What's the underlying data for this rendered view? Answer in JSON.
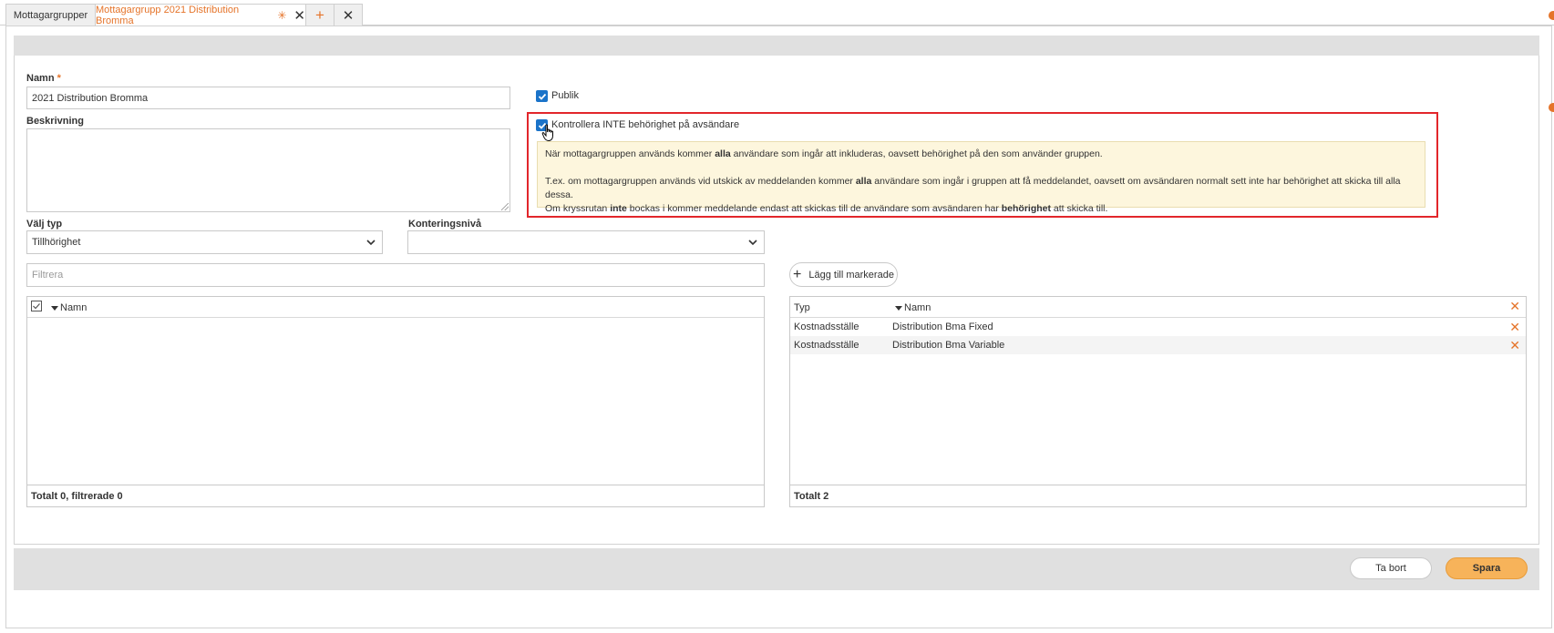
{
  "tabs": [
    {
      "label": "Mottagargrupper",
      "active": false
    },
    {
      "label": "Mottagargrupp 2021 Distribution Bromma",
      "active": true,
      "modified_marker": "✳"
    }
  ],
  "tab_add_icon": "plus-icon",
  "tab_close_all_icon": "close-icon",
  "form": {
    "name_label": "Namn",
    "required_marker": "*",
    "name_value": "2021 Distribution Bromma",
    "description_label": "Beskrivning",
    "description_value": "",
    "type_label": "Välj typ",
    "type_value": "Tillhörighet",
    "accounting_label": "Konteringsnivå",
    "accounting_value": "",
    "filter_placeholder": "Filtrera",
    "public_label": "Publik",
    "public_checked": true,
    "no_permission_check_label": "Kontrollera INTE behörighet på avsändare",
    "no_permission_check_checked": true
  },
  "info": {
    "line1_a": "När mottagargruppen används kommer ",
    "line1_b": "alla",
    "line1_c": " användare som ingår att inkluderas, oavsett behörighet på den som använder gruppen.",
    "line2_a": "T.ex. om mottagargruppen används vid utskick av meddelanden kommer ",
    "line2_b": "alla",
    "line2_c": " användare som ingår i gruppen att få meddelandet, oavsett om avsändaren normalt sett inte har behörighet att skicka till alla dessa.",
    "line3_a": "Om kryssrutan ",
    "line3_b": "inte",
    "line3_c": " bockas i kommer meddelande endast att skickas till de användare som avsändaren har ",
    "line3_d": "behörighet",
    "line3_e": " att skicka till."
  },
  "add_selected_label": "Lägg till markerade",
  "left_list": {
    "col_name": "Namn",
    "footer": "Totalt 0, filtrerade 0",
    "rows": []
  },
  "right_list": {
    "col_type": "Typ",
    "col_name": "Namn",
    "footer": "Totalt 2",
    "rows": [
      {
        "type": "Kostnadsställe",
        "name": "Distribution Bma Fixed"
      },
      {
        "type": "Kostnadsställe",
        "name": "Distribution Bma Variable"
      }
    ]
  },
  "buttons": {
    "delete_label": "Ta bort",
    "save_label": "Spara"
  },
  "colors": {
    "accent": "#e5742a",
    "checkbox": "#1a73c9",
    "highlight_border": "#e2262b",
    "info_bg": "#fdf6dd",
    "save_bg": "#f7b35a"
  }
}
